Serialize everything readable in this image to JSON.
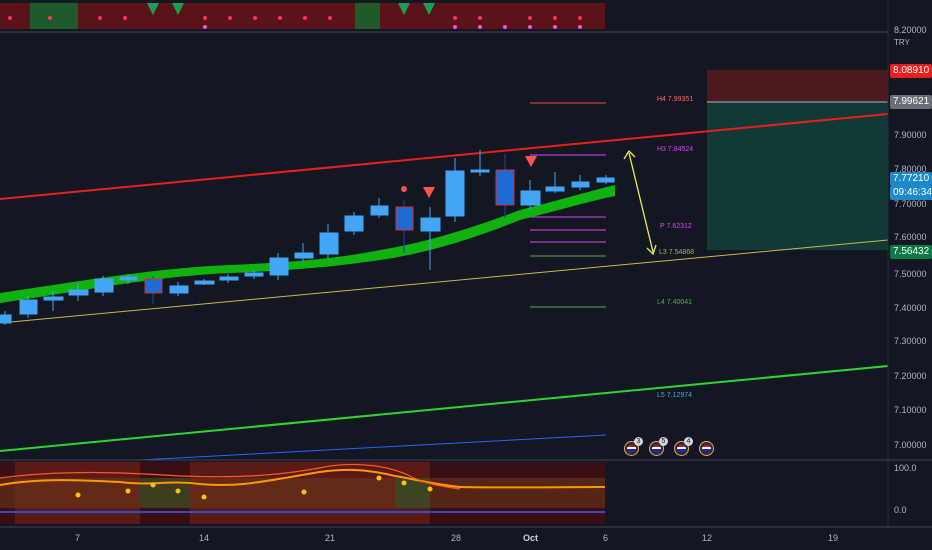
{
  "symbol_currency": "TRY",
  "price_axis": {
    "ticks": [
      "8.20000",
      "7.90000",
      "7.80000",
      "7.70000",
      "7.60000",
      "7.50000",
      "7.40000",
      "7.30000",
      "7.20000",
      "7.10000",
      "7.00000"
    ],
    "current_price": "7.77210",
    "countdown": "09:46:34",
    "red_level": "8.08910",
    "gray_level": "7.99621",
    "green_level": "7.56432"
  },
  "date_axis": [
    "7",
    "14",
    "21",
    "28",
    "Oct",
    "6",
    "12",
    "19"
  ],
  "pivots": {
    "h4": "H4 7.99351",
    "h3": "H3 7.84524",
    "p": "P 7.62312",
    "l3": "L3 7.54868",
    "l4": "L4 7.40041",
    "l5": "L5 7.12974"
  },
  "event_badges": [
    {
      "count": "3"
    },
    {
      "count": "5"
    },
    {
      "count": "4"
    },
    {
      "count": ""
    }
  ],
  "oscillator": {
    "ticks": [
      "100.0",
      "0.0"
    ]
  },
  "colors": {
    "background": "#131722",
    "candle": "#42a5f5",
    "candle_dark": "#1e6bd6",
    "ribbon": "#0fb20f",
    "upper_channel": "#e91e1e",
    "lower_channel": "#c9b84a",
    "green_line": "#2ed52e",
    "arrow": "#f1e94a"
  }
}
